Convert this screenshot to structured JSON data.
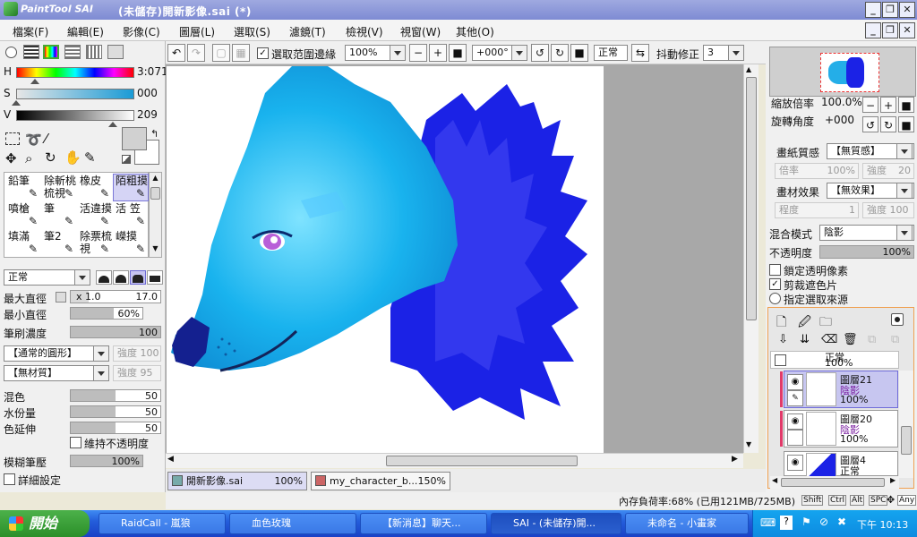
{
  "window": {
    "logo_text": "PaintTool SAI",
    "title": "(未儲存)開新影像.sai (*)"
  },
  "menu": [
    "檔案(F)",
    "編輯(E)",
    "影像(C)",
    "圖層(L)",
    "選取(S)",
    "濾鏡(T)",
    "檢視(V)",
    "視窗(W)",
    "其他(O)"
  ],
  "toolbar": {
    "selection_edge_label": "選取范圍邊緣",
    "selection_edge_checked": true,
    "zoom": "100%",
    "rotation": "+000°",
    "mode": "正常",
    "stabilizer_label": "抖動修正",
    "stabilizer_value": "3"
  },
  "color": {
    "h_label": "H",
    "h_value": "3:071",
    "s_label": "S",
    "s_value": "000",
    "v_label": "V",
    "v_value": "209",
    "h_level": 0.16,
    "s_level": 0.0,
    "v_level": 0.82
  },
  "tools": [
    {
      "label": "鉛筆",
      "selected": false
    },
    {
      "label": "除斬桃梳視",
      "selected": false
    },
    {
      "label": "橡皮",
      "selected": false
    },
    {
      "label": "陌粗摸",
      "selected": true
    },
    {
      "label": "噴槍",
      "selected": false
    },
    {
      "label": "筆",
      "selected": false
    },
    {
      "label": "活違摸",
      "selected": false
    },
    {
      "label": "活  笠",
      "selected": false
    },
    {
      "label": "填滿",
      "selected": false
    },
    {
      "label": "筆2",
      "selected": false
    },
    {
      "label": "除票梳視",
      "selected": false
    },
    {
      "label": "嶸摸",
      "selected": false
    }
  ],
  "brush": {
    "blend_mode": "正常",
    "max_size_label": "最大直徑",
    "max_size_mult": "x 1.0",
    "max_size_value": "17.0",
    "min_size_label": "最小直徑",
    "min_size_value": "60%",
    "min_size_level": 0.6,
    "density_label": "筆刷濃度",
    "density_value": "100",
    "shape": "【通常的圓形】",
    "shape_strength": "強度 100",
    "texture": "【無材質】",
    "texture_strength": "強度  95",
    "blend_label": "混色",
    "blend_value": "50",
    "water_label": "水份量",
    "water_value": "50",
    "persist_label": "色延伸",
    "persist_value": "50",
    "keep_opacity_label": "維持不透明度",
    "blur_label": "模糊筆壓",
    "blur_value": "100%",
    "detail_label": "詳細設定"
  },
  "navigator": {
    "zoom_label": "縮放倍率",
    "zoom_value": "100.0%",
    "rotate_label": "旋轉角度",
    "rotate_value": "+000"
  },
  "layer_props": {
    "paper_label": "畫紙質感",
    "paper_value": "【無質感】",
    "paper_scale": "倍率",
    "paper_scale_value": "100%",
    "paper_strength": "強度",
    "paper_strength_value": "20",
    "effect_label": "畫材效果",
    "effect_value": "【無效果】",
    "effect_degree": "程度",
    "effect_degree_value": "1",
    "effect_strength": "強度 100",
    "blend_label": "混合模式",
    "blend_value": "陰影",
    "opacity_label": "不透明度",
    "opacity_value": "100%",
    "lock_alpha_label": "鎖定透明像素",
    "clip_label": "剪裁遮色片",
    "clip_checked": true,
    "select_src_label": "指定選取來源"
  },
  "layers": [
    {
      "name": "圖層21",
      "mode": "陰影",
      "opacity": "100%",
      "selected": true
    },
    {
      "name": "圖層20",
      "mode": "陰影",
      "opacity": "100%",
      "selected": false
    },
    {
      "name": "圖層4",
      "mode": "正常",
      "opacity": "",
      "selected": false
    }
  ],
  "layer_partial": {
    "name": "正常",
    "opacity": "100%"
  },
  "doc_tabs": [
    {
      "name": "開新影像.sai",
      "zoom": "100%"
    },
    {
      "name": "my_character_b...",
      "zoom": "150%"
    }
  ],
  "status": {
    "memory": "內存負荷率:68% (已用121MB/725MB)",
    "keys": [
      "Shift",
      "Ctrl",
      "Alt",
      "SPC",
      "Any"
    ]
  },
  "taskbar": {
    "start": "開始",
    "tasks": [
      "RaidCall - 嵐狼",
      "血色玫瑰",
      "【新消息】聊天...",
      "SAI - (未儲存)開...",
      "未命名 - 小畫家"
    ],
    "clock": "下午 10:13"
  },
  "colors": {
    "wolf_light": "#2fb5f0",
    "wolf_mane": "#1a1ee0",
    "eye": "#b85fd8",
    "layer_mode_text": "#7a1fa0"
  }
}
